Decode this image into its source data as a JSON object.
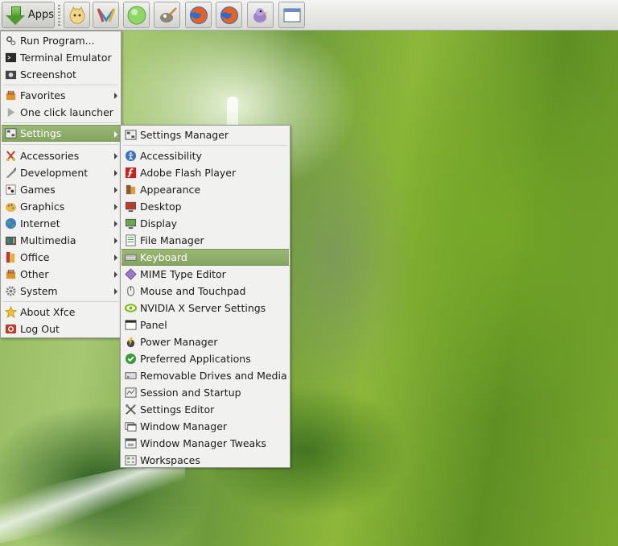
{
  "panel": {
    "apps_label": "Apps",
    "launchers": [
      "cat-icon",
      "mail-icon",
      "green-circle-icon",
      "gimp-icon",
      "firefox-icon",
      "firefox-icon",
      "pidgin-icon",
      "window-icon"
    ]
  },
  "main_menu": {
    "items": [
      {
        "label": "Run Program...",
        "icon": "run-program-icon"
      },
      {
        "label": "Terminal Emulator",
        "icon": "terminal-icon"
      },
      {
        "label": "Screenshot",
        "icon": "screenshot-icon"
      },
      {
        "label": "Favorites",
        "icon": "favorites-icon"
      },
      {
        "label": "One click launcher",
        "icon": "play-icon"
      },
      {
        "label": "Settings",
        "icon": "settings-icon"
      },
      {
        "label": "Accessories",
        "icon": "accessories-icon"
      },
      {
        "label": "Development",
        "icon": "development-icon"
      },
      {
        "label": "Games",
        "icon": "games-icon"
      },
      {
        "label": "Graphics",
        "icon": "graphics-icon"
      },
      {
        "label": "Internet",
        "icon": "internet-icon"
      },
      {
        "label": "Multimedia",
        "icon": "multimedia-icon"
      },
      {
        "label": "Office",
        "icon": "office-icon"
      },
      {
        "label": "Other",
        "icon": "other-icon"
      },
      {
        "label": "System",
        "icon": "system-icon"
      },
      {
        "label": "About Xfce",
        "icon": "star-icon"
      },
      {
        "label": "Log Out",
        "icon": "logout-icon"
      }
    ]
  },
  "settings_menu": {
    "items": [
      {
        "label": "Settings Manager"
      },
      {
        "label": "Accessibility"
      },
      {
        "label": "Adobe Flash Player"
      },
      {
        "label": "Appearance"
      },
      {
        "label": "Desktop"
      },
      {
        "label": "Display"
      },
      {
        "label": "File Manager"
      },
      {
        "label": "Keyboard"
      },
      {
        "label": "MIME Type Editor"
      },
      {
        "label": "Mouse and Touchpad"
      },
      {
        "label": "NVIDIA X Server Settings"
      },
      {
        "label": "Panel"
      },
      {
        "label": "Power Manager"
      },
      {
        "label": "Preferred Applications"
      },
      {
        "label": "Removable Drives and Media"
      },
      {
        "label": "Session and Startup"
      },
      {
        "label": "Settings Editor"
      },
      {
        "label": "Window Manager"
      },
      {
        "label": "Window Manager Tweaks"
      },
      {
        "label": "Workspaces"
      }
    ]
  },
  "colors": {
    "highlight": "#8fad6a",
    "menu_bg": "#f1f1ef",
    "panel_bg": "#e6e6e3"
  }
}
